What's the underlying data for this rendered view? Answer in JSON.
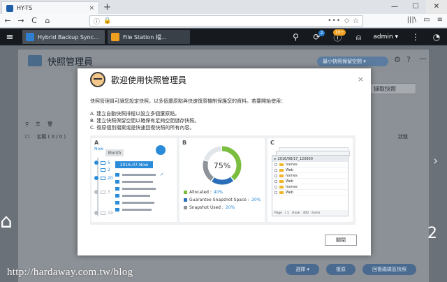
{
  "browser": {
    "tab_title": "HY-TS",
    "tab_close": "×",
    "new_tab": "+",
    "win_min": "—",
    "win_max": "☐",
    "win_close": "✕",
    "back": "←",
    "forward": "→",
    "reload": "C",
    "home": "⌂",
    "url_info": "ⓘ",
    "url_lock": "🔒",
    "url_dots": "•••",
    "url_shield": "◇",
    "url_star": "☆",
    "library": "|||\\",
    "sidebar": "▭",
    "menu": "≡"
  },
  "qts": {
    "menu_icon": "≡",
    "apps": [
      {
        "label": "Hybrid Backup Sync...",
        "icon_color": "#2f7fd1"
      },
      {
        "label": "File Station 檔...",
        "icon_color": "#f0a020"
      }
    ],
    "search_icon": "⚲",
    "notif_badge": "2",
    "info_badge": "10+",
    "user": "admin ▾",
    "more_icon": "⋮",
    "dash_icon": "◔"
  },
  "app": {
    "title": "快照管理員",
    "pill": "最小快照保留空間 ▾",
    "side_button": "擷取快照",
    "table_header": {
      "name": "名稱 ( 0 / 0 )",
      "status": "狀態"
    },
    "bottom_buttons": [
      "選擇 ▾",
      "復原",
      "回復磁碟區快照"
    ],
    "desk_left": "⌂",
    "desk_right": "2",
    "chevron": "›"
  },
  "modal": {
    "title": "歡迎使用快照管理員",
    "close": "×",
    "description": "快照管理員可讓您設定快照，以多個還原點與快速復原機制保護您的資料。若要開始使用：",
    "steps": [
      "A. 建立自動快照排程以設立多個還原點。",
      "B. 建立快照保留空間以確保有足夠空間儲存快照。",
      "C. 復原個別檔案或是快速回復快照的所有內容。"
    ],
    "panel_labels": [
      "A",
      "B",
      "C"
    ],
    "panel_a": {
      "now": "Now",
      "month": "Month",
      "date": "2016-07-Now",
      "days": [
        "5",
        "2",
        "20",
        "3",
        "19"
      ],
      "check": "✓"
    },
    "panel_b": {
      "percent": "75%",
      "legend": [
        {
          "label": "Allocated : ",
          "value": "40%",
          "color": "#7bbd3f"
        },
        {
          "label": "Guarantee Snapshot Space : ",
          "value": "20%",
          "color": "#2a6fb8"
        },
        {
          "label": "Snapshot Used : ",
          "value": "20%",
          "color": "#8d9399"
        }
      ],
      "donut": {
        "allocated": 40,
        "guarantee": 20,
        "used": 20,
        "remainder": 20
      }
    },
    "panel_c": {
      "snapshot_name": "2016/08/17_120900",
      "folders": [
        "homes",
        "Web",
        "homes",
        "Web",
        "homes",
        "Web"
      ],
      "footer": {
        "page": "Page",
        "of": "/ 1",
        "show": "show",
        "count": "300",
        "items": "items"
      }
    },
    "close_button": "關閉"
  },
  "watermark": "http://hardaway.com.tw/blog"
}
